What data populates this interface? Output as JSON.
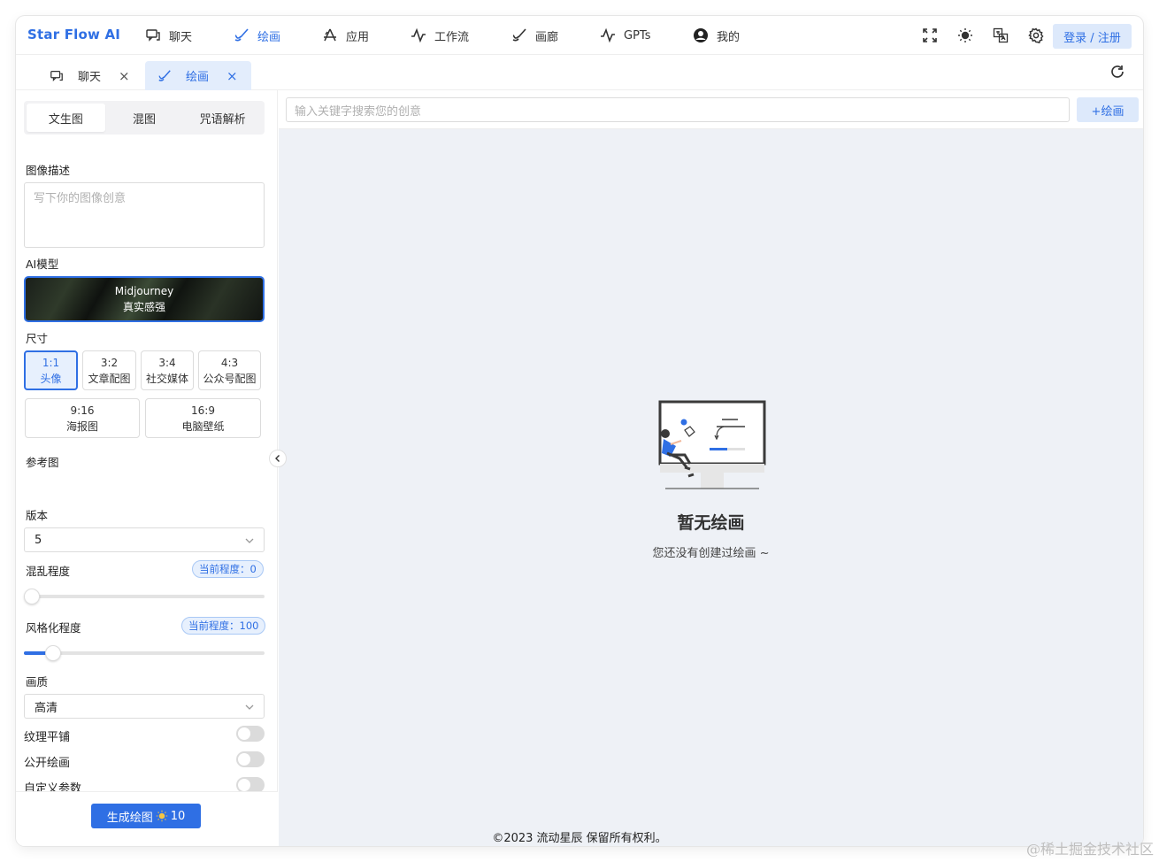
{
  "brand": "Star Flow AI",
  "nav": [
    {
      "label": "聊天",
      "icon": "chat-icon"
    },
    {
      "label": "绘画",
      "icon": "brush-icon",
      "active": true
    },
    {
      "label": "应用",
      "icon": "app-icon"
    },
    {
      "label": "工作流",
      "icon": "workflow-icon"
    },
    {
      "label": "画廊",
      "icon": "gallery-icon"
    },
    {
      "label": "GPTs",
      "icon": "gpts-icon"
    },
    {
      "label": "我的",
      "icon": "user-icon"
    }
  ],
  "toolbar": {
    "login_label": "登录 / 注册",
    "icons": [
      "fullscreen-icon",
      "sun-icon",
      "translate-icon",
      "settings-icon"
    ]
  },
  "tabs": [
    {
      "label": "聊天",
      "icon": "chat-icon",
      "close": "×"
    },
    {
      "label": "绘画",
      "icon": "brush-icon",
      "close": "×",
      "active": true
    }
  ],
  "left": {
    "modes": [
      "文生图",
      "混图",
      "咒语解析"
    ],
    "active_mode": "文生图",
    "desc_label": "图像描述",
    "desc_placeholder": "写下你的图像创意",
    "model_label": "AI模型",
    "model_name": "Midjourney",
    "model_desc": "真实感强",
    "size_label": "尺寸",
    "sizes": [
      {
        "ratio": "1:1",
        "name": "头像",
        "active": true
      },
      {
        "ratio": "3:2",
        "name": "文章配图"
      },
      {
        "ratio": "3:4",
        "name": "社交媒体"
      },
      {
        "ratio": "4:3",
        "name": "公众号配图"
      },
      {
        "ratio": "9:16",
        "name": "海报图"
      },
      {
        "ratio": "16:9",
        "name": "电脑壁纸"
      }
    ],
    "ref_label": "参考图",
    "version_label": "版本",
    "version_value": "5",
    "chaos_label": "混乱程度",
    "chaos_pill": "当前程度：0",
    "chaos_value": 0,
    "stylize_label": "风格化程度",
    "stylize_pill": "当前程度：100",
    "stylize_value": 0.12,
    "quality_label": "画质",
    "quality_value": "高清",
    "toggles": [
      {
        "label": "纹理平铺",
        "on": false
      },
      {
        "label": "公开绘画",
        "on": false
      },
      {
        "label": "自定义参数",
        "on": false
      }
    ],
    "generate_label": "生成绘图",
    "generate_cost": "10"
  },
  "main": {
    "search_placeholder": "输入关键字搜索您的创意",
    "add_label": "+绘画",
    "empty_title": "暂无绘画",
    "empty_sub": "您还没有创建过绘画 ~"
  },
  "footer": "©2023 流动星辰 保留所有权利。",
  "watermark": "@稀土掘金技术社区",
  "colors": {
    "accent": "#2f6fe4",
    "accent_light": "#dde9fb",
    "bg_main": "#eef1f6"
  }
}
